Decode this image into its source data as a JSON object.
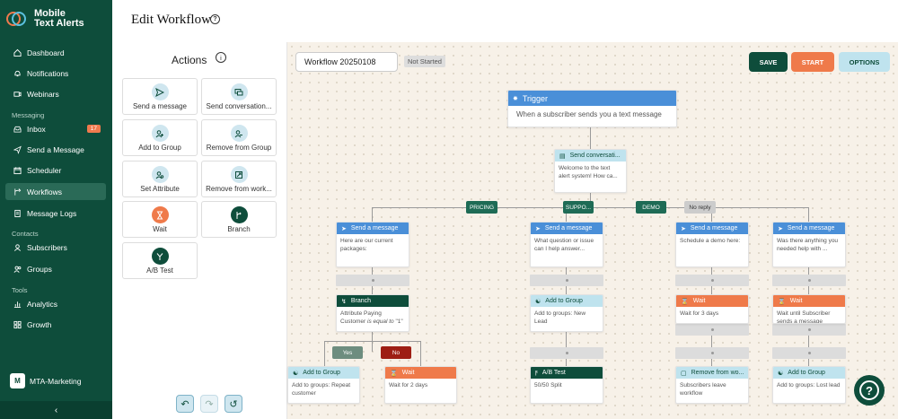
{
  "brand": {
    "name_line1": "Mobile",
    "name_line2": "Text Alerts"
  },
  "nav": {
    "dashboard": "Dashboard",
    "notifications": "Notifications",
    "webinars": "Webinars",
    "section_messaging": "Messaging",
    "inbox": "Inbox",
    "inbox_badge": "17",
    "send_message": "Send a Message",
    "scheduler": "Scheduler",
    "workflows": "Workflows",
    "message_logs": "Message Logs",
    "section_contacts": "Contacts",
    "subscribers": "Subscribers",
    "groups": "Groups",
    "section_tools": "Tools",
    "analytics": "Analytics",
    "growth": "Growth"
  },
  "org": {
    "initial": "M",
    "name": "MTA-Marketing"
  },
  "header": {
    "title": "Edit Workflow"
  },
  "actions": {
    "title": "Actions",
    "items": [
      "Send a message",
      "Send conversation...",
      "Add to Group",
      "Remove from Group",
      "Set Attribute",
      "Remove from work...",
      "Wait",
      "Branch",
      "A/B Test"
    ]
  },
  "toolbar": {
    "workflow_name": "Workflow 20250108",
    "status": "Not Started",
    "save": "SAVE",
    "start": "START",
    "options": "OPTIONS"
  },
  "canvas": {
    "trigger": {
      "title": "Trigger",
      "body": "When a subscriber sends you a text message"
    },
    "convo": {
      "title": "Send conversati...",
      "body": "Welcome to the text alert system! How ca..."
    },
    "tags": {
      "pricing": "PRICING",
      "support": "SUPPO...",
      "demo": "DEMO",
      "noreply": "No reply"
    },
    "col1": {
      "msg_title": "Send a message",
      "msg_body": "Here are our current packages:",
      "branch_title": "Branch",
      "branch_body_1": "Attribute Paying",
      "branch_body_2": "Customer",
      "branch_body_3": "is equal to",
      "branch_body_4": "\"1\"",
      "yes": "Yes",
      "no": "No",
      "group_title": "Add to Group",
      "group_body": "Add to groups: Repeat customer",
      "wait_title": "Wait",
      "wait_body": "Wait for 2 days"
    },
    "col2": {
      "msg_title": "Send a message",
      "msg_body": "What question or issue can I help answer...",
      "group_title": "Add to Group",
      "group_body": "Add to groups: New Lead",
      "ab_title": "A/B Test",
      "ab_body": "50/50 Split"
    },
    "col3": {
      "msg_title": "Send a message",
      "msg_body": "Schedule a demo here:",
      "wait_title": "Wait",
      "wait_body": "Wait for 3 days",
      "remove_title": "Remove from wo...",
      "remove_body": "Subscribers leave workflow"
    },
    "col4": {
      "msg_title": "Send a message",
      "msg_body": "Was there anything you needed help with ...",
      "wait_title": "Wait",
      "wait_body": "Wait until Subscriber sends a message",
      "group_title": "Add to Group",
      "group_body": "Add to groups: Lost lead"
    }
  },
  "colors": {
    "brand_green": "#0e4d3b",
    "accent_orange": "#ef7a4a",
    "info_blue": "#4a8fd8",
    "light_blue": "#bfe3ee"
  }
}
